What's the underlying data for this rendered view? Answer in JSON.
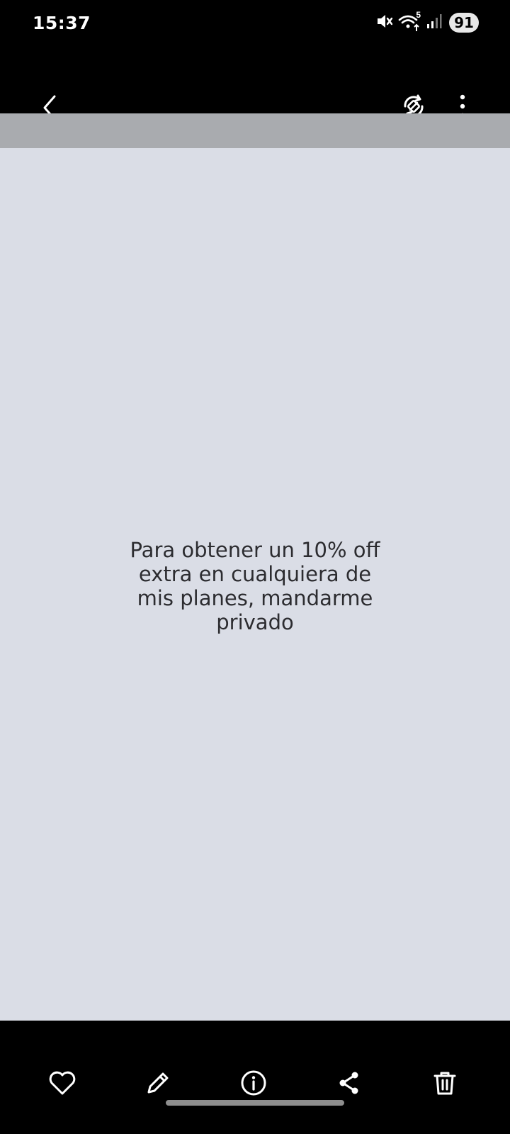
{
  "status_bar": {
    "time": "15:37",
    "network_label": "5",
    "battery": "91",
    "icons": [
      "mute-icon",
      "wifi-icon",
      "signal-icon"
    ]
  },
  "viewer": {
    "top_icons": [
      "back-icon",
      "auto-rotate-icon",
      "more-options-icon"
    ],
    "image_text": "Para obtener un 10% off extra en cualquiera de mis planes, mandarme privado",
    "image_background": "#dadde6",
    "strip_color": "#a9abaf"
  },
  "bottom_bar": {
    "icons": [
      "favorite-icon",
      "edit-icon",
      "info-icon",
      "share-icon",
      "delete-icon"
    ]
  }
}
